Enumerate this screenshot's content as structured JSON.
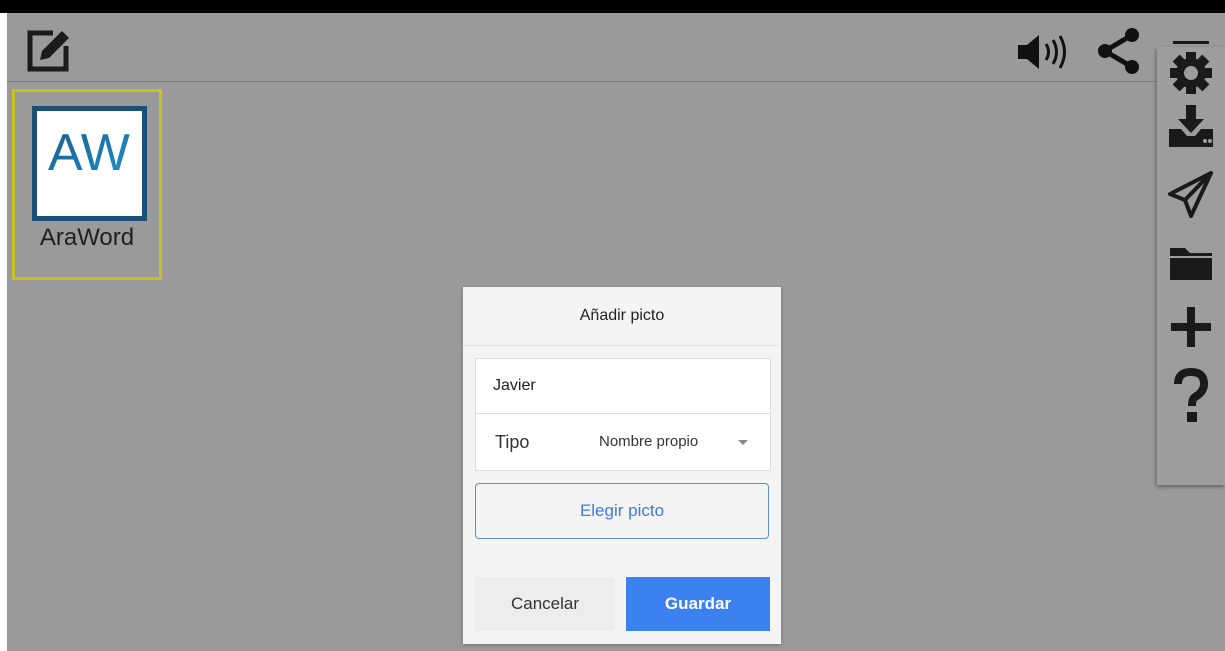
{
  "toolbar": {
    "edit_icon": "edit-square-icon",
    "sound_icon": "speaker-volume-icon",
    "share_icon": "share-icon",
    "settings_icon": "gear-icon"
  },
  "apps": [
    {
      "logo_text": "AW",
      "label": "AraWord",
      "selected": true,
      "highlight_color": "#c6c320"
    }
  ],
  "side_menu": {
    "items": [
      "gear-icon",
      "download-tray-icon",
      "paper-plane-icon",
      "folder-icon",
      "plus-icon",
      "question-mark-icon"
    ]
  },
  "dialog": {
    "title": "Añadir picto",
    "name_value": "Javier",
    "name_placeholder": "",
    "type_label": "Tipo",
    "type_value": "Nombre propio",
    "choose_label": "Elegir picto",
    "cancel_label": "Cancelar",
    "save_label": "Guardar"
  },
  "colors": {
    "overlay_background": "#9a9a9a",
    "accent_blue": "#3b82f0",
    "selection_yellow": "#c6c320",
    "logo_blue": "#1c4f75"
  }
}
